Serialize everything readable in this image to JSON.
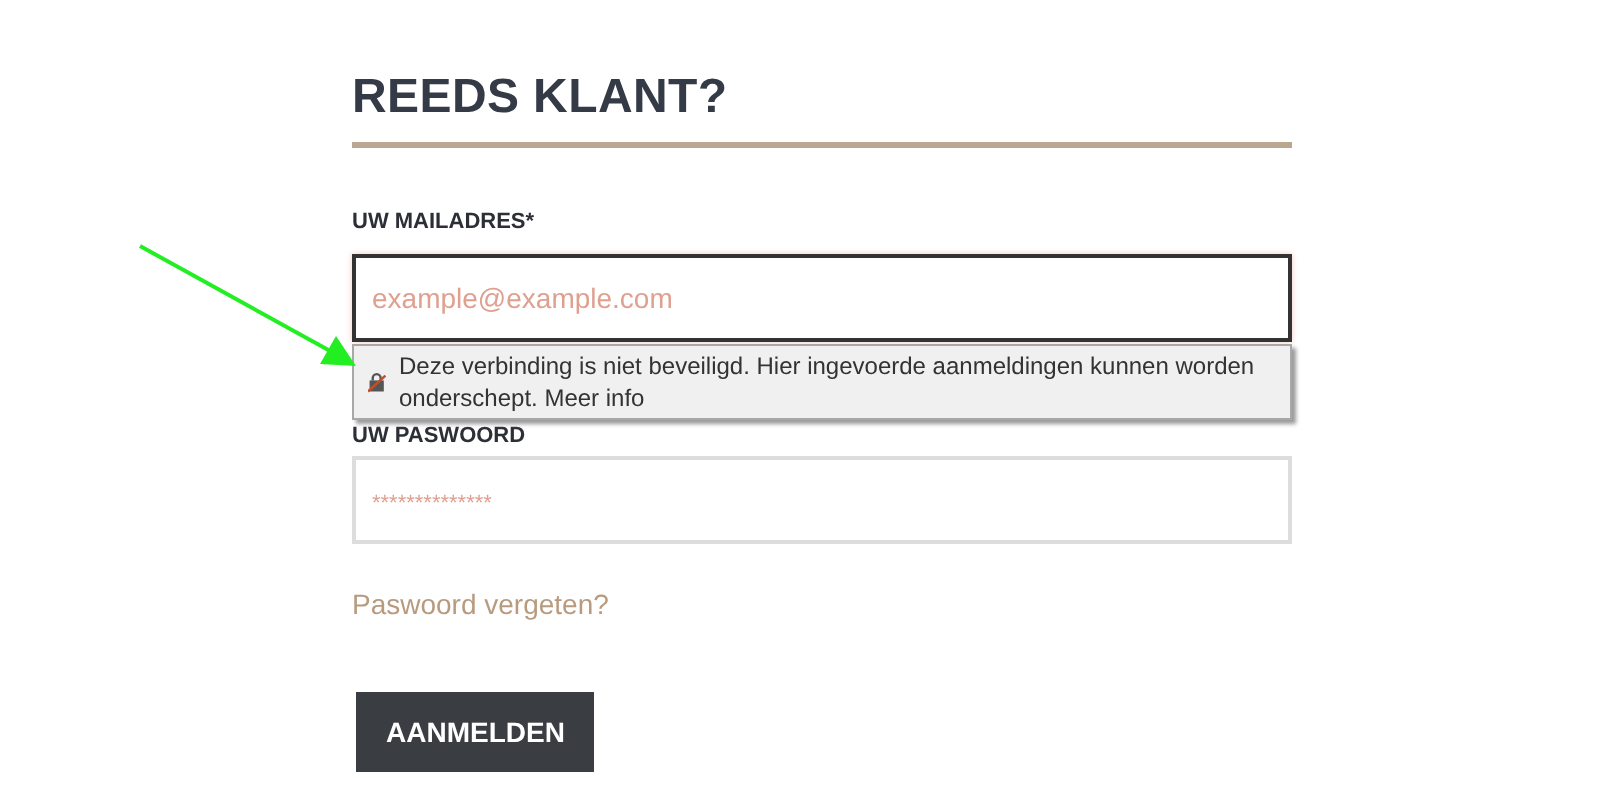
{
  "heading": "REEDS KLANT?",
  "email": {
    "label": "UW MAILADRES*",
    "placeholder": "example@example.com"
  },
  "warning": {
    "text": "Deze verbinding is niet beveiligd. Hier ingevoerde aanmeldingen kunnen worden onderschept.",
    "link": "Meer info"
  },
  "password": {
    "label": "UW PASWOORD",
    "placeholder": "**************"
  },
  "forgot_link": "Paswoord vergeten?",
  "submit_button": "AANMELDEN"
}
